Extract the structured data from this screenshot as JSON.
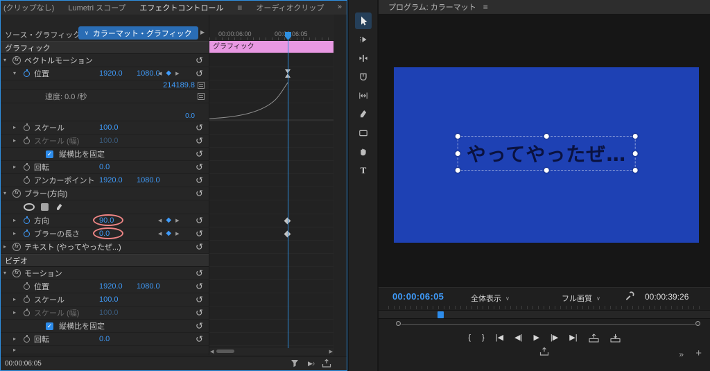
{
  "colors": {
    "panel_focus_border": "#2e8fe0",
    "accent_blue": "#2d8ceb",
    "value_blue": "#3f9bfa",
    "clip_pink": "#e898e2",
    "video_blue": "#1e41b4",
    "annotation_red": "#ee8585"
  },
  "left_panel": {
    "tabs": [
      {
        "label": "(クリップなし)",
        "active": false
      },
      {
        "label": "Lumetri スコープ",
        "active": false
      },
      {
        "label": "エフェクトコントロール",
        "active": true
      },
      {
        "label": "オーディオクリップ",
        "active": false
      }
    ],
    "menu_icon": "≡",
    "overflow_chevron": "»",
    "source_label": "ソース・グラフィック",
    "clip_selector": "カラーマット・グラフィック",
    "ruler_ticks": [
      "00:00:06:00",
      "00:00:06:05"
    ],
    "clip_name": "グラフィック",
    "bottom_timecode": "00:00:06:05",
    "rows": [
      {
        "type": "section",
        "label": "グラフィック"
      },
      {
        "type": "effect",
        "chevron": "down",
        "fx": true,
        "label": "ベクトルモーション",
        "reset": true
      },
      {
        "type": "prop",
        "chevron": "down",
        "stopwatch": "on",
        "label": "位置",
        "values": [
          "1920.0",
          "1080.0"
        ],
        "keynav": true,
        "reset": true,
        "tl": "hourglass"
      },
      {
        "type": "value",
        "value": "214189.8"
      },
      {
        "type": "speed",
        "label": "速度: 0.0 /秒"
      },
      {
        "type": "graph",
        "min_value": "0.0"
      },
      {
        "type": "prop",
        "chevron": "right",
        "stopwatch": "off",
        "label": "スケール",
        "values": [
          "100.0"
        ],
        "reset": true
      },
      {
        "type": "prop",
        "chevron": "right",
        "stopwatch": "off",
        "label": "スケール (幅)",
        "values": [
          "100.0"
        ],
        "dim": true,
        "reset": true
      },
      {
        "type": "check",
        "checked": true,
        "label": "縦横比を固定",
        "reset": true
      },
      {
        "type": "prop",
        "chevron": "right",
        "stopwatch": "off",
        "label": "回転",
        "values": [
          "0.0"
        ],
        "reset": true
      },
      {
        "type": "prop",
        "stopwatch": "off",
        "label": "アンカーポイント",
        "values": [
          "1920.0",
          "1080.0"
        ],
        "reset": true
      },
      {
        "type": "effect",
        "chevron": "down",
        "fx": true,
        "label": "ブラー(方向)",
        "reset": true
      },
      {
        "type": "mask"
      },
      {
        "type": "prop",
        "chevron": "right",
        "stopwatch": "on",
        "label": "方向",
        "values": [
          "90.0"
        ],
        "keynav": true,
        "reset": true,
        "annotate": true,
        "tl": "diamond"
      },
      {
        "type": "prop",
        "chevron": "right",
        "stopwatch": "on",
        "label": "ブラーの長さ",
        "values": [
          "0.0"
        ],
        "keynav": true,
        "reset": true,
        "annotate": true,
        "tl": "diamond"
      },
      {
        "type": "effect",
        "chevron": "right",
        "fx": true,
        "label": "テキスト (やってやったぜ...)",
        "reset": true
      },
      {
        "type": "section",
        "label": "ビデオ"
      },
      {
        "type": "effect",
        "chevron": "down",
        "fx": true,
        "label": "モーション",
        "reset": true
      },
      {
        "type": "prop",
        "stopwatch": "off",
        "label": "位置",
        "values": [
          "1920.0",
          "1080.0"
        ],
        "reset": true
      },
      {
        "type": "prop",
        "chevron": "right",
        "stopwatch": "off",
        "label": "スケール",
        "values": [
          "100.0"
        ],
        "reset": true
      },
      {
        "type": "prop",
        "chevron": "right",
        "stopwatch": "off",
        "label": "スケール (幅)",
        "values": [
          "100.0"
        ],
        "dim": true,
        "reset": true
      },
      {
        "type": "check",
        "checked": true,
        "label": "縦横比を固定",
        "reset": true
      },
      {
        "type": "prop",
        "chevron": "right",
        "stopwatch": "off",
        "label": "回転",
        "values": [
          "0.0"
        ],
        "reset": true
      },
      {
        "type": "partial"
      }
    ]
  },
  "tools": [
    {
      "name": "selection-tool",
      "active": true
    },
    {
      "name": "track-select-forward-tool"
    },
    {
      "name": "ripple-edit-tool"
    },
    {
      "name": "razor-tool"
    },
    {
      "name": "slip-tool"
    },
    {
      "name": "pen-tool"
    },
    {
      "name": "rectangle-tool"
    },
    {
      "name": "hand-tool"
    },
    {
      "name": "type-tool"
    }
  ],
  "program": {
    "title": "プログラム: カラーマット",
    "menu_icon": "≡",
    "canvas_text": "やってやったぜ…",
    "current_timecode": "00:00:06:05",
    "zoom_level": "全体表示",
    "playback_quality": "フル画質",
    "duration": "00:00:39:26",
    "transport": [
      {
        "name": "mark-in-button",
        "glyph": "{"
      },
      {
        "name": "mark-out-button",
        "glyph": "}"
      },
      {
        "name": "go-to-in-button",
        "glyph": "|◀"
      },
      {
        "name": "step-back-button",
        "glyph": "◀|"
      },
      {
        "name": "play-button",
        "glyph": "▶"
      },
      {
        "name": "step-forward-button",
        "glyph": "|▶"
      },
      {
        "name": "go-to-out-button",
        "glyph": "▶|"
      },
      {
        "name": "lift-button"
      },
      {
        "name": "extract-button"
      }
    ],
    "panel_expand": "»",
    "add_button": "+"
  }
}
